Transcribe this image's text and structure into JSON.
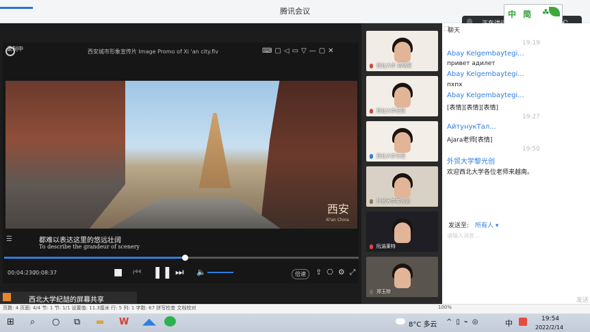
{
  "app": {
    "title": "腾讯会议"
  },
  "speaking": {
    "label": "正在讲话："
  },
  "logo": {
    "text": "中 简",
    "heart": "☘♥"
  },
  "player": {
    "record_label": "录制中",
    "file_title": "西安城市形象宣传片 Image Promo of Xi 'an city.flv",
    "window_controls": "⌨▢◁▭▽—▢✕",
    "subtitle_cn": "都难以表达这里的悠远壮阔",
    "subtitle_en": "To describe the grandeur of scenery",
    "brand_mark": "西安",
    "brand_sub": "Xi'an China",
    "time_current": "00:04:23 /",
    "time_total": "00:08:37",
    "progress": 0.51,
    "speed_label": "倍速",
    "icons": [
      "stop-icon",
      "prev-icon",
      "pause-icon",
      "next-icon",
      "volume-icon"
    ]
  },
  "share_bar": {
    "label": "西北大学纪喆的屏幕共享"
  },
  "participants": [
    {
      "name": "西北大学 高璐莹",
      "bg": "#f1ece6",
      "accent": "#c84b3b"
    },
    {
      "name": "西北大学纪喆",
      "bg": "#f2ede7",
      "accent": "#c84b3b"
    },
    {
      "name": "西北大学王媛",
      "bg": "#f3eee8",
      "accent": "#2f7de1"
    },
    {
      "name": "外贸大学黎光创",
      "bg": "#d9d1c5",
      "accent": "#8a7a66"
    },
    {
      "name": "阮渝莱特",
      "bg": "#1e1e24",
      "accent": "#e34545"
    },
    {
      "name": "郑玉赊",
      "bg": "#5a544f",
      "accent": "#7a6c62"
    }
  ],
  "chat": {
    "tab_label": "聊天",
    "timestamps": [
      "19:19",
      "19:27",
      "19:50"
    ],
    "messages": [
      {
        "name": "Abay Kelgembaytegi...",
        "text": "привет адилет"
      },
      {
        "name": "Abay Kelgembaytegi...",
        "text": "пхпх"
      },
      {
        "name": "Abay Kelgembaytegi...",
        "text": "[表情][表情][表情]"
      },
      {
        "name": "АйтунукТал...",
        "text": "Ajara老师[表情]"
      },
      {
        "name": "外贸大学黎光创",
        "text": "欢迎西北大学各位老师来越南。"
      }
    ],
    "send_to_label": "发送至:",
    "send_target": "所有人 ▾",
    "input_placeholder": "请输入消息...",
    "send_button": "发送"
  },
  "status_bar": {
    "text": "页数: 4   页面: 4/4   节: 1   节: 1/1   设置值: 11.3厘米   行: 5   列: 1   字数: 67   拼写检查   文档校对",
    "right": "100%"
  },
  "taskbar": {
    "weather_temp": "8°C 多云",
    "lang": "中",
    "time": "19:54",
    "date": "2022/2/14"
  }
}
